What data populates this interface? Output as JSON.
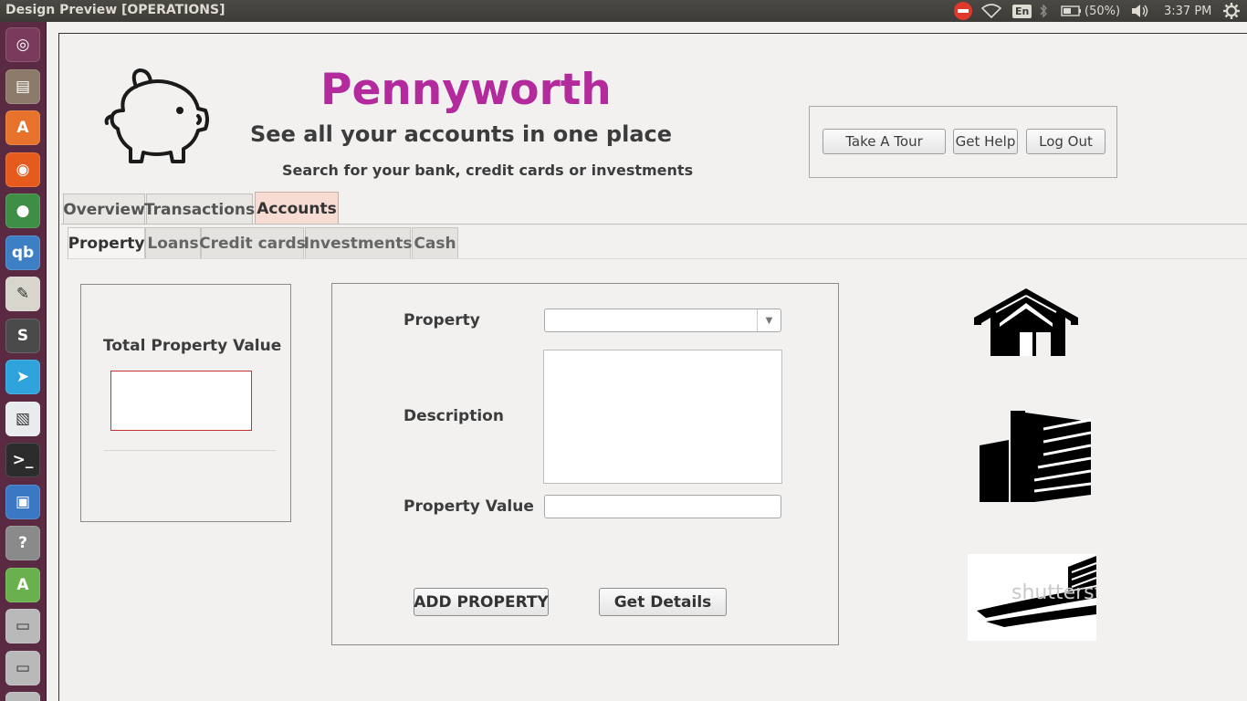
{
  "window": {
    "title": "Design Preview [OPERATIONS]"
  },
  "system_tray": {
    "keyboard_layout": "En",
    "battery": "(50%)",
    "clock": "3:37 PM"
  },
  "launcher": {
    "items": [
      {
        "name": "dash-home",
        "glyph": "◎",
        "color": "#7a3a5c"
      },
      {
        "name": "files",
        "glyph": "▤",
        "color": "#8c7a6a"
      },
      {
        "name": "software-center",
        "glyph": "A",
        "color": "#e6722b"
      },
      {
        "name": "firefox",
        "glyph": "◉",
        "color": "#e55b1d"
      },
      {
        "name": "chrome",
        "glyph": "●",
        "color": "#3f8e46"
      },
      {
        "name": "qbittorrent",
        "glyph": "qb",
        "color": "#3d7fc4"
      },
      {
        "name": "text-editor",
        "glyph": "✎",
        "color": "#d8d5cc"
      },
      {
        "name": "sublime-text",
        "glyph": "S",
        "color": "#4a4a4a"
      },
      {
        "name": "telegram",
        "glyph": "➤",
        "color": "#2fa3dc"
      },
      {
        "name": "libreoffice-writer",
        "glyph": "▧",
        "color": "#e9ecef"
      },
      {
        "name": "terminal",
        "glyph": ">_",
        "color": "#2c2c2c"
      },
      {
        "name": "virtualbox",
        "glyph": "▣",
        "color": "#3a78c4"
      },
      {
        "name": "help",
        "glyph": "?",
        "color": "#8a8a8a"
      },
      {
        "name": "android-studio",
        "glyph": "A",
        "color": "#6ab04c"
      },
      {
        "name": "disk-1",
        "glyph": "▭",
        "color": "#b9b9b9"
      },
      {
        "name": "disk-2",
        "glyph": "▭",
        "color": "#b9b9b9"
      },
      {
        "name": "trash",
        "glyph": "▭",
        "color": "#b9b9b9"
      }
    ]
  },
  "header": {
    "title": "Pennyworth",
    "subtitle": "See all your accounts in one place",
    "search_hint": "Search for your bank, credit cards or investments",
    "title_color": "#b32a9d"
  },
  "actions": {
    "tour": "Take A Tour",
    "help": "Get Help",
    "logout": "Log Out"
  },
  "tabs": [
    {
      "label": "Overview"
    },
    {
      "label": "Transactions"
    },
    {
      "label": "Accounts"
    }
  ],
  "subtabs": [
    {
      "label": "Property"
    },
    {
      "label": "Loans"
    },
    {
      "label": "Credit cards"
    },
    {
      "label": "Investments"
    },
    {
      "label": "Cash"
    }
  ],
  "summary": {
    "total_label": "Total Property Value",
    "total_value": ""
  },
  "form": {
    "property_label": "Property",
    "property_selected": "",
    "description_label": "Description",
    "description_value": "",
    "value_label": "Property Value",
    "value_value": "",
    "add_button": "ADD PROPERTY",
    "details_button": "Get Details"
  },
  "images": {
    "stadium_watermark": "shutterstock"
  }
}
